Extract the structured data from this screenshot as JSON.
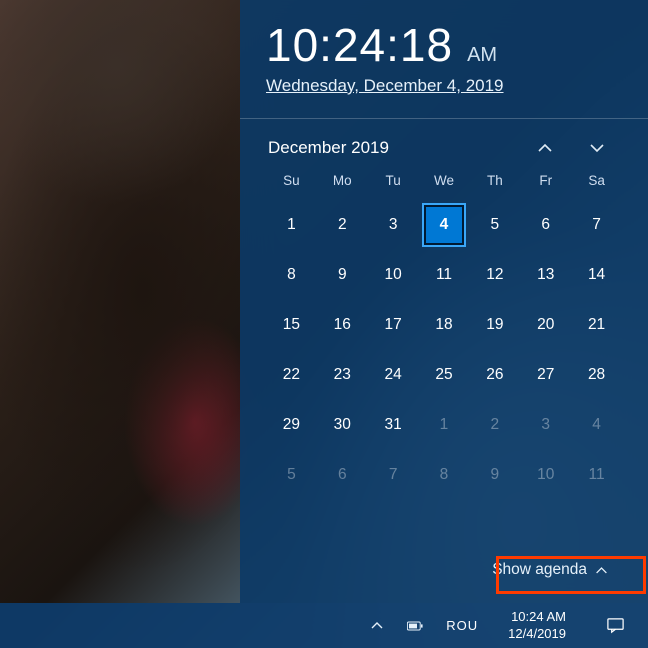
{
  "clock": {
    "time": "10:24:18",
    "ampm": "AM",
    "date_full": "Wednesday, December 4, 2019"
  },
  "calendar": {
    "month_label": "December 2019",
    "dow": [
      "Su",
      "Mo",
      "Tu",
      "We",
      "Th",
      "Fr",
      "Sa"
    ],
    "weeks": [
      [
        {
          "d": "1"
        },
        {
          "d": "2"
        },
        {
          "d": "3"
        },
        {
          "d": "4",
          "today": true
        },
        {
          "d": "5"
        },
        {
          "d": "6"
        },
        {
          "d": "7"
        }
      ],
      [
        {
          "d": "8"
        },
        {
          "d": "9"
        },
        {
          "d": "10"
        },
        {
          "d": "11"
        },
        {
          "d": "12"
        },
        {
          "d": "13"
        },
        {
          "d": "14"
        }
      ],
      [
        {
          "d": "15"
        },
        {
          "d": "16"
        },
        {
          "d": "17"
        },
        {
          "d": "18"
        },
        {
          "d": "19"
        },
        {
          "d": "20"
        },
        {
          "d": "21"
        }
      ],
      [
        {
          "d": "22"
        },
        {
          "d": "23"
        },
        {
          "d": "24"
        },
        {
          "d": "25"
        },
        {
          "d": "26"
        },
        {
          "d": "27"
        },
        {
          "d": "28"
        }
      ],
      [
        {
          "d": "29"
        },
        {
          "d": "30"
        },
        {
          "d": "31"
        },
        {
          "d": "1",
          "other": true
        },
        {
          "d": "2",
          "other": true
        },
        {
          "d": "3",
          "other": true
        },
        {
          "d": "4",
          "other": true
        }
      ],
      [
        {
          "d": "5",
          "other": true
        },
        {
          "d": "6",
          "other": true
        },
        {
          "d": "7",
          "other": true
        },
        {
          "d": "8",
          "other": true
        },
        {
          "d": "9",
          "other": true
        },
        {
          "d": "10",
          "other": true
        },
        {
          "d": "11",
          "other": true
        }
      ]
    ]
  },
  "agenda": {
    "label": "Show agenda"
  },
  "taskbar": {
    "language": "ROU",
    "time": "10:24 AM",
    "date": "12/4/2019"
  }
}
